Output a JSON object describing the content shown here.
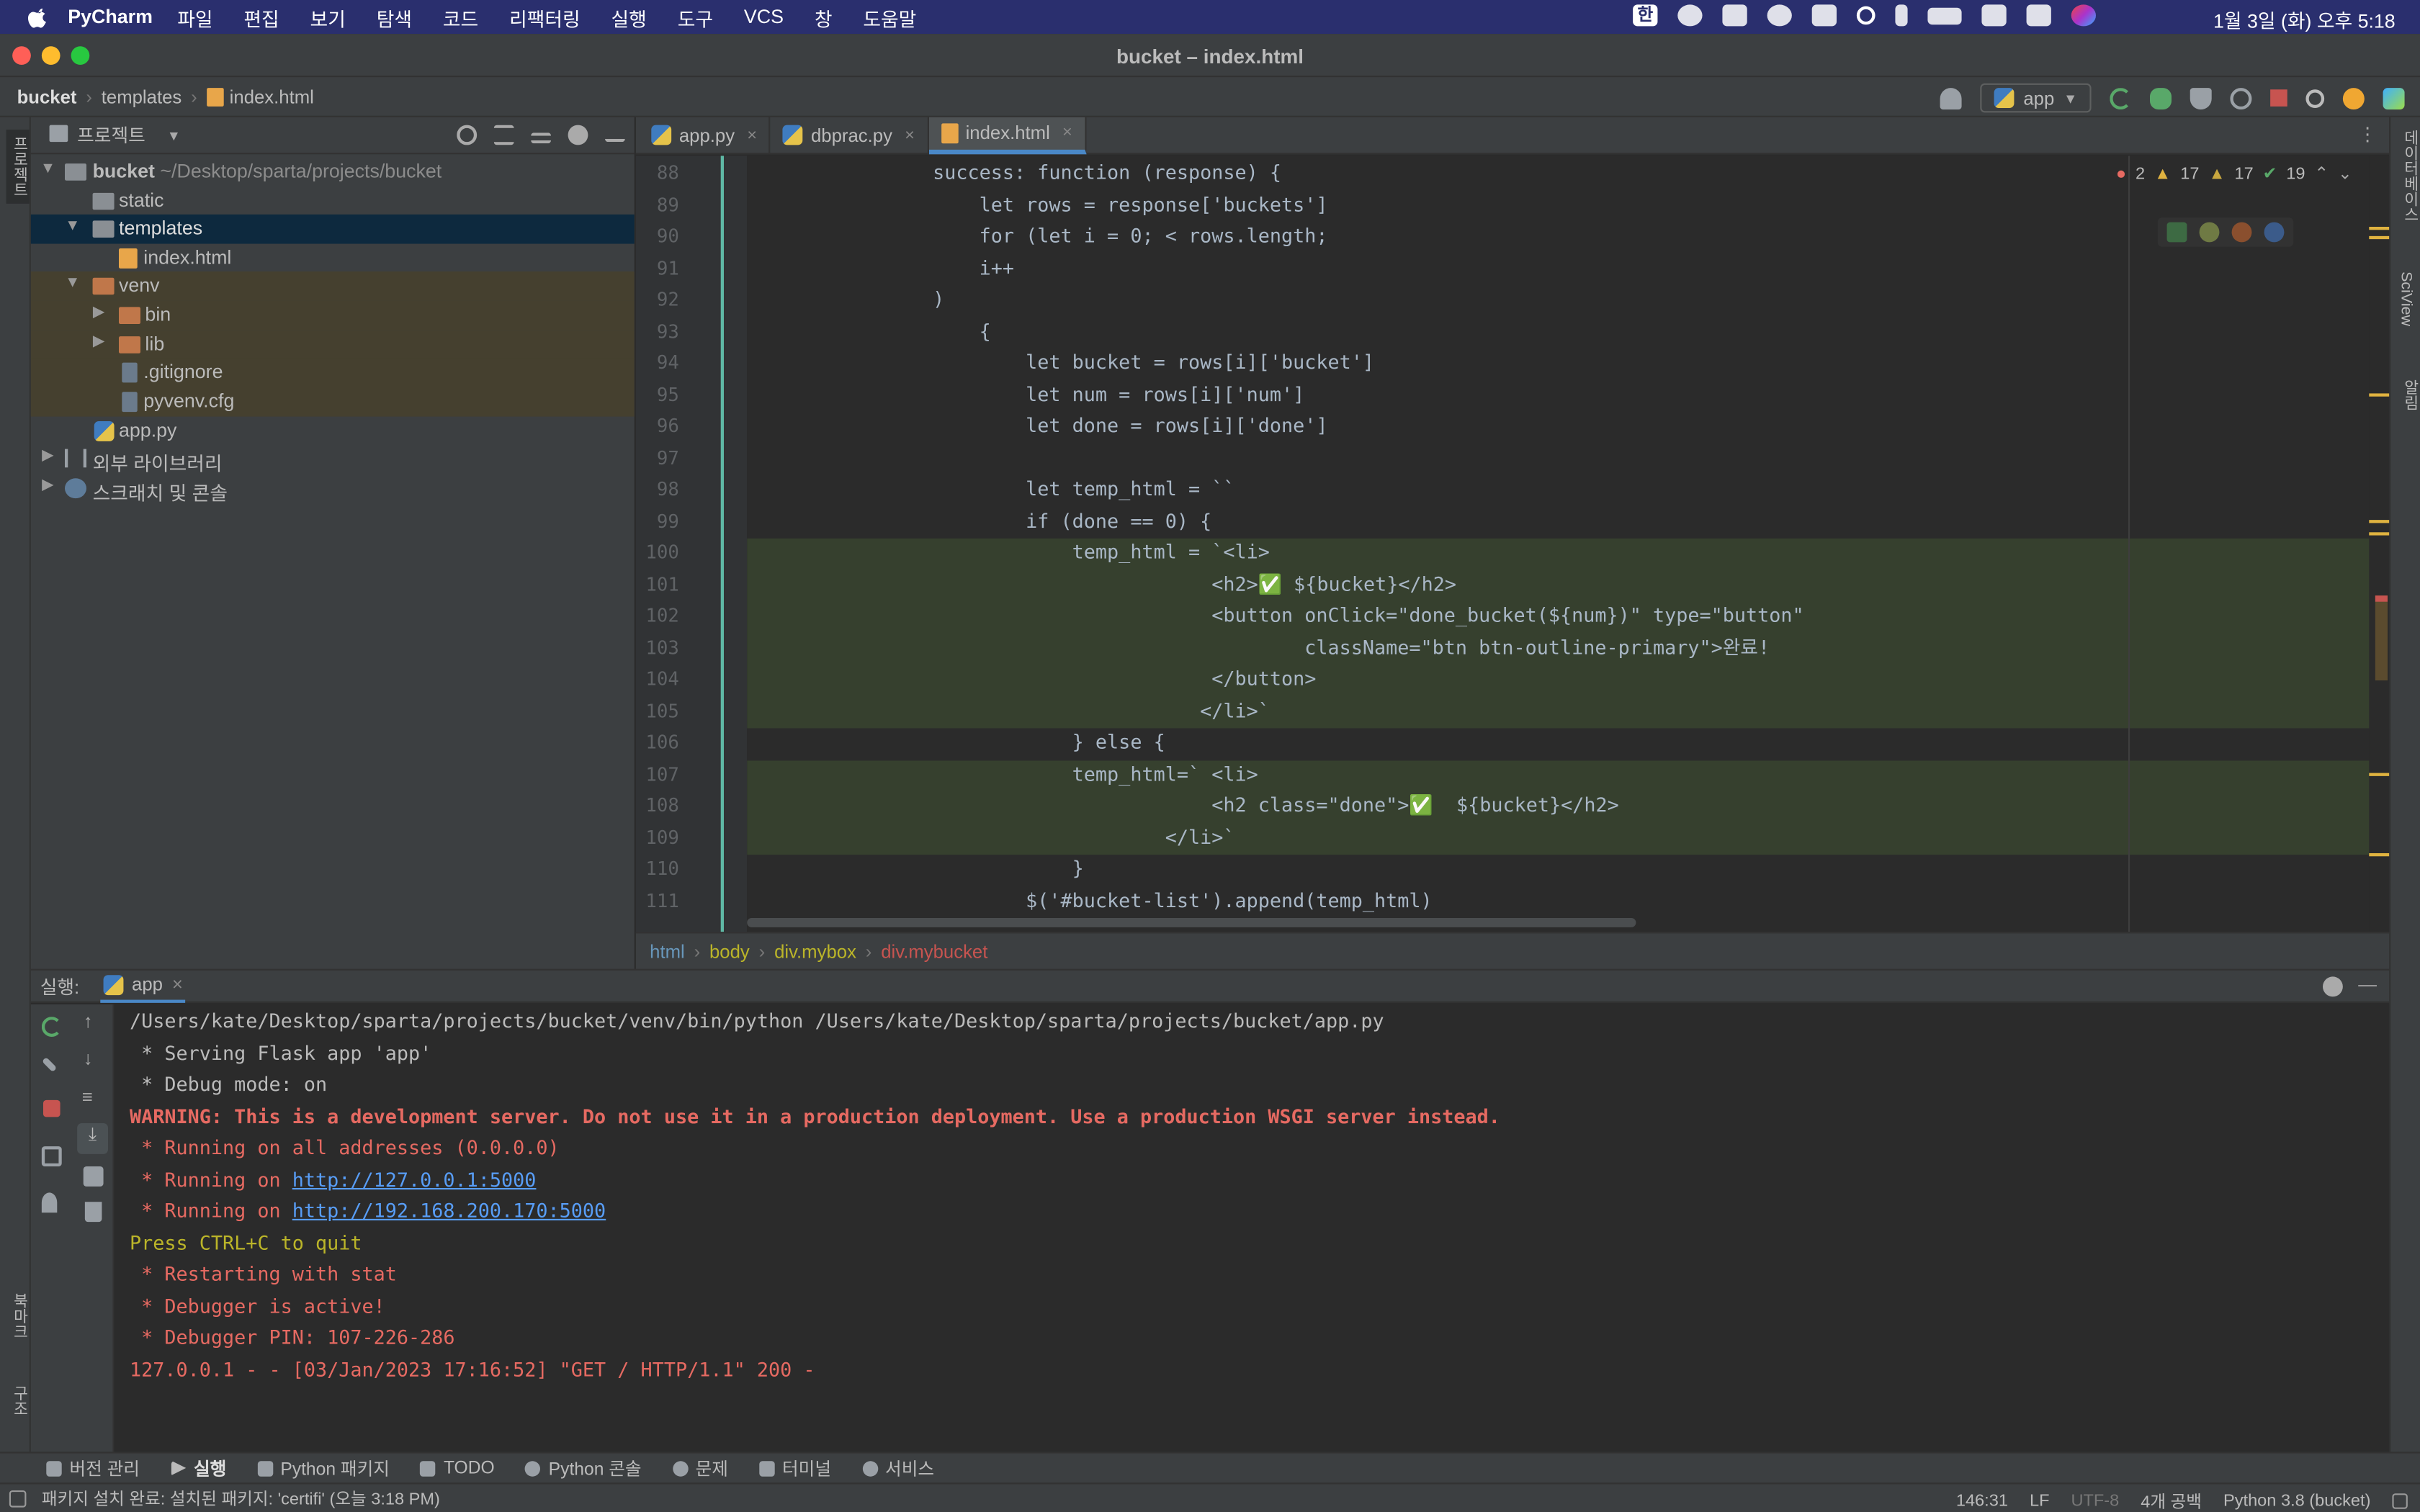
{
  "menubar": {
    "app_name": "PyCharm",
    "items": [
      "파일",
      "편집",
      "보기",
      "탐색",
      "코드",
      "리팩터링",
      "실행",
      "도구",
      "VCS",
      "창",
      "도움말"
    ],
    "input_method": "한",
    "clock": "1월 3일 (화) 오후 5:18"
  },
  "window": {
    "title": "bucket – index.html"
  },
  "navbar": {
    "crumbs": [
      "bucket",
      "templates",
      "index.html"
    ],
    "run_config": "app"
  },
  "left_strip": {
    "project_label": "프로젝트",
    "bookmarks_label": "북마크",
    "structure_label": "구조"
  },
  "right_strip": {
    "database_label": "데이터베이스",
    "sciview_label": "SciView",
    "notifications_label": "알림"
  },
  "project": {
    "header": "프로젝트",
    "tree": [
      {
        "label": "bucket",
        "extra": "~/Desktop/sparta/projects/bucket"
      },
      {
        "label": "static"
      },
      {
        "label": "templates"
      },
      {
        "label": "index.html"
      },
      {
        "label": "venv"
      },
      {
        "label": "bin"
      },
      {
        "label": "lib"
      },
      {
        "label": ".gitignore"
      },
      {
        "label": "pyvenv.cfg"
      },
      {
        "label": "app.py"
      },
      {
        "label": "외부 라이브러리"
      },
      {
        "label": "스크래치 및 콘솔"
      }
    ]
  },
  "editor": {
    "tabs": [
      "app.py",
      "dbprac.py",
      "index.html"
    ],
    "inspections": {
      "errors": "2",
      "warnings": "17",
      "weak": "17",
      "ok": "19"
    },
    "line_numbers": [
      "88",
      "89",
      "90",
      "91",
      "92",
      "93",
      "94",
      "95",
      "96",
      "97",
      "98",
      "99",
      "100",
      "101",
      "102",
      "103",
      "104",
      "105",
      "106",
      "107",
      "108",
      "109",
      "110",
      "111"
    ],
    "lines": [
      "                success: function (response) {",
      "                    let rows = response['buckets']",
      "                    for (let i = 0; < rows.length;",
      "                    i++",
      "                )",
      "                    {",
      "                        let bucket = rows[i]['bucket']",
      "                        let num = rows[i]['num']",
      "                        let done = rows[i]['done']",
      "",
      "                        let temp_html = ``",
      "                        if (done == 0) {",
      "                            temp_html = `<li>",
      "                                        <h2>✅ ${bucket}</h2>",
      "                                        <button onClick=\"done_bucket(${num})\" type=\"button\"",
      "                                                className=\"btn btn-outline-primary\">완료!",
      "                                        </button>",
      "                                       </li>`",
      "                            } else {",
      "                            temp_html=` <li>",
      "                                        <h2 class=\"done\">✅  ${bucket}</h2>",
      "                                    </li>`",
      "                            }",
      "                        $('#bucket-list').append(temp_html)"
    ],
    "crumbs": [
      "html",
      "body",
      "div.mybox",
      "div.mybucket"
    ]
  },
  "run": {
    "label": "실행:",
    "tab": "app",
    "console": [
      "/Users/kate/Desktop/sparta/projects/bucket/venv/bin/python /Users/kate/Desktop/sparta/projects/bucket/app.py",
      " * Serving Flask app 'app'",
      " * Debug mode: on",
      "WARNING: This is a development server. Do not use it in a production deployment. Use a production WSGI server instead.",
      " * Running on all addresses (0.0.0.0)",
      " * Running on ",
      " * Running on ",
      "Press CTRL+C to quit",
      " * Restarting with stat",
      " * Debugger is active!",
      " * Debugger PIN: 107-226-286",
      "127.0.0.1 - - [03/Jan/2023 17:16:52] \"GET / HTTP/1.1\" 200 -"
    ],
    "links": [
      "http://127.0.0.1:5000",
      "http://192.168.200.170:5000"
    ]
  },
  "bottom_tabs": [
    "버전 관리",
    "실행",
    "Python 패키지",
    "TODO",
    "Python 콘솔",
    "문제",
    "터미널",
    "서비스"
  ],
  "status": {
    "message": "패키지 설치 완료: 설치된 패키지: 'certifi' (오늘 3:18 PM)",
    "position": "146:31",
    "line_sep": "LF",
    "encoding": "UTF-8",
    "indent": "4개 공백",
    "interpreter": "Python 3.8 (bucket)"
  },
  "colors": {
    "menubar": "#2a2f6e",
    "panel": "#3c3f41",
    "editor_bg": "#2b2b2b",
    "highlight": "#36402e",
    "error": "#e66a62",
    "link": "#589df6"
  }
}
